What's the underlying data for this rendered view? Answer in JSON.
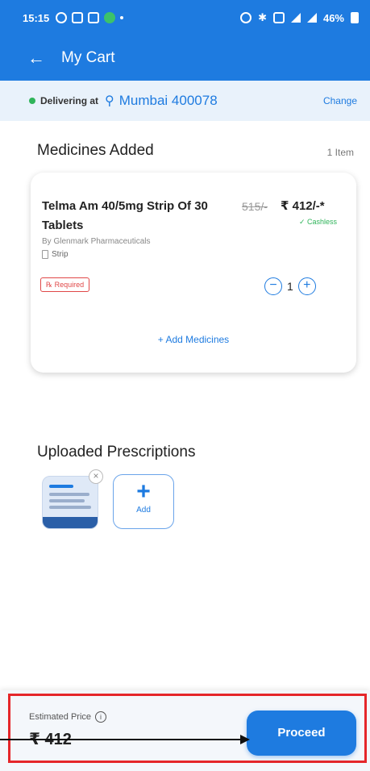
{
  "status_bar": {
    "time": "15:15",
    "battery": "46%"
  },
  "app_bar": {
    "back_icon": "arrow-left-icon",
    "title": "My Cart"
  },
  "delivery": {
    "label": "Delivering at",
    "location": "Mumbai 400078",
    "change_label": "Change"
  },
  "medicines": {
    "heading": "Medicines Added",
    "count_label": "1 Item",
    "items": [
      {
        "name": "Telma Am 40/5mg Strip Of 30 Tablets",
        "mrp": "515/-",
        "price": "₹ 412/-*",
        "payment_tag": "✓ Cashless",
        "manufacturer": "By Glenmark Pharmaceuticals",
        "pack": "Strip",
        "rx_badge": "℞ Required",
        "quantity": "1"
      }
    ],
    "add_more_label": "+ Add Medicines"
  },
  "prescriptions": {
    "heading": "Uploaded Prescriptions",
    "add_label": "Add"
  },
  "footer": {
    "estimated_label": "Estimated Price",
    "estimated_value": "₹ 412",
    "proceed_label": "Proceed"
  },
  "colors": {
    "brand_blue": "#1e7be0",
    "highlight_red": "#e5262a",
    "success_green": "#2fb45a"
  }
}
